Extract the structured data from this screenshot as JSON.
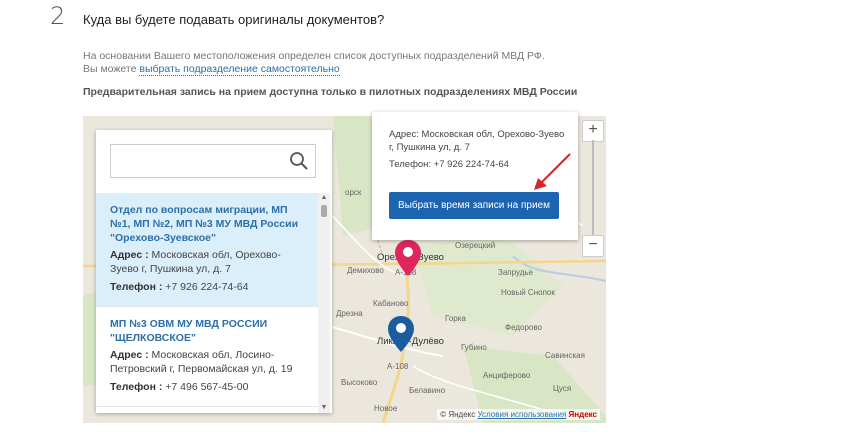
{
  "step": {
    "number": "2",
    "title": "Куда вы будете подавать оригиналы документов?"
  },
  "info": {
    "line1": "На основании Вашего местоположения определен список доступных подразделений МВД РФ.",
    "line2_prefix": "Вы можете ",
    "line2_link": "выбрать подразделение самостоятельно"
  },
  "note": "Предварительная запись на прием доступна только в пилотных подразделениях МВД России",
  "search": {
    "value": "",
    "placeholder": ""
  },
  "list": {
    "address_label": "Адрес :",
    "phone_label": "Телефон :",
    "items": [
      {
        "name": "Отдел по вопросам миграции, МП №1, МП №2, МП №3 МУ МВД России \"Орехово-Зуевское\"",
        "address": "Московская обл, Орехово-Зуево г, Пушкина ул, д. 7",
        "phone": "+7 926 224-74-64",
        "selected": true
      },
      {
        "name": "МП №3 ОВМ МУ МВД РОССИИ \"ЩЕЛКОВСКОЕ\"",
        "address": "Московская обл, Лосино-Петровский г, Первомайская ул, д. 19",
        "phone": "+7 496 567-45-00",
        "selected": false
      }
    ]
  },
  "balloon": {
    "address": "Адрес: Московская обл, Орехово-Зуево г, Пушкина ул, д. 7",
    "phone": "Телефон: +7 926 224-74-64",
    "button_label": "Выбрать время записи на прием"
  },
  "map": {
    "places": {
      "orekhovo": "Орехово-Зуево",
      "likino": "Ликино-Дулёво",
      "ozeretsky": "Озерецкий",
      "demikhovo": "Демихово",
      "drezna": "Дрезна",
      "kabanovo": "Кабаново",
      "novy_snopok": "Новый Снопок",
      "gubino": "Губино",
      "savinskaya": "Савинская",
      "novoe": "Новое",
      "vysokovo": "Высоково",
      "zaprudye": "Запрудье",
      "fedorovo": "Федорово",
      "antsiferovo": "Анциферово",
      "beleva": "Белавино",
      "gora": "Горка",
      "tsusya": "Цуся",
      "a108_1": "А-108",
      "a108_2": "А-108",
      "orsk": "орск"
    },
    "credit": "© Яндекс",
    "terms": "Условия использования",
    "logo": "Яндекс",
    "zoom_in": "+",
    "zoom_out": "−",
    "colors": {
      "pin_red": "#e0245e",
      "pin_blue": "#1a5c9e",
      "button": "#1c64b0",
      "arrow": "#d0282e"
    }
  }
}
